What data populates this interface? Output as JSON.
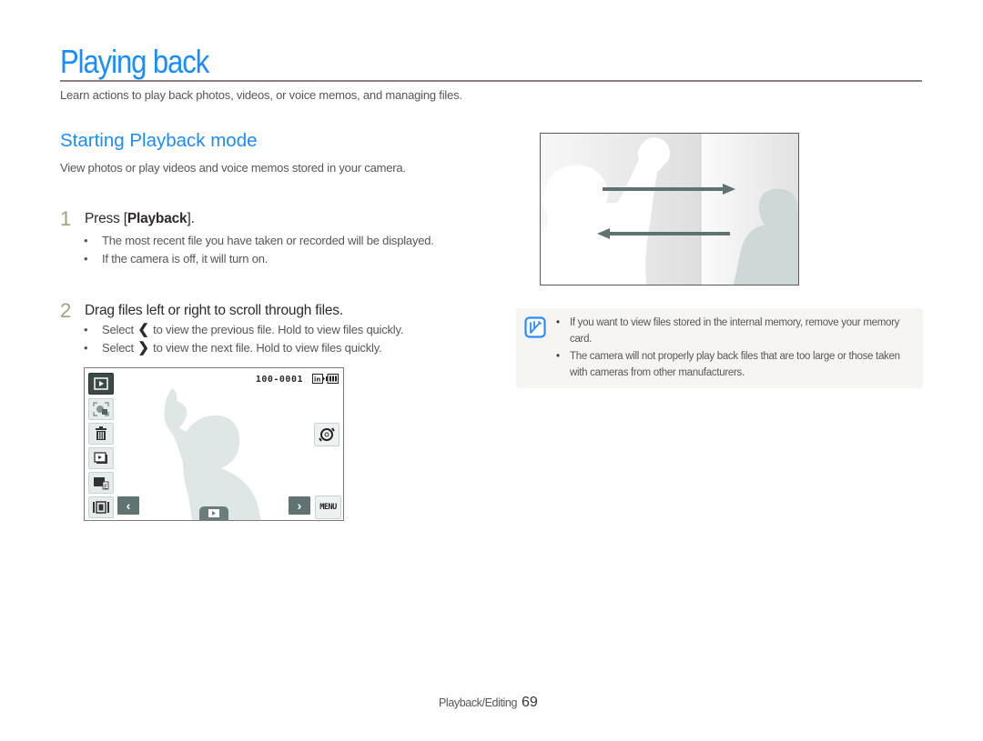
{
  "page": {
    "title": "Playing back",
    "intro": "Learn actions to play back photos, videos, or voice memos, and managing files.",
    "accent_color": "#1a8cff"
  },
  "section": {
    "title": "Starting Playback mode",
    "description": "View photos or play videos and voice memos stored in your camera."
  },
  "steps": [
    {
      "number": "1",
      "text_prefix": "Press [",
      "text_bold": "Playback",
      "text_suffix": "].",
      "bullets": [
        "The most recent file you have taken or recorded will be displayed.",
        "If the camera is off, it will turn on."
      ]
    },
    {
      "number": "2",
      "text": "Drag files left or right to scroll through files.",
      "bullets": [
        {
          "prefix": "Select",
          "icon": "chevron-left-icon",
          "glyph": "❮",
          "suffix": "to view the previous file. Hold to view files quickly."
        },
        {
          "prefix": "Select",
          "icon": "chevron-right-icon",
          "glyph": "❯",
          "suffix": "to view the next file. Hold to view files quickly."
        }
      ]
    }
  ],
  "camera_screen": {
    "file_counter": "100-0001",
    "menu_label": "MENU",
    "prev_glyph": "‹",
    "next_glyph": "›",
    "side_buttons": [
      "playback-mode-icon",
      "face-recognition-icon",
      "delete-icon",
      "slideshow-icon",
      "edit-icon",
      "display-icon"
    ]
  },
  "note": {
    "icon": "note-pencil-icon",
    "items": [
      "If you want to view files stored in the internal memory, remove your memory card.",
      "The camera will not properly play back files that are too large or those taken with cameras from other manufacturers."
    ]
  },
  "footer": {
    "section": "Playback/Editing",
    "page_number": "69"
  }
}
